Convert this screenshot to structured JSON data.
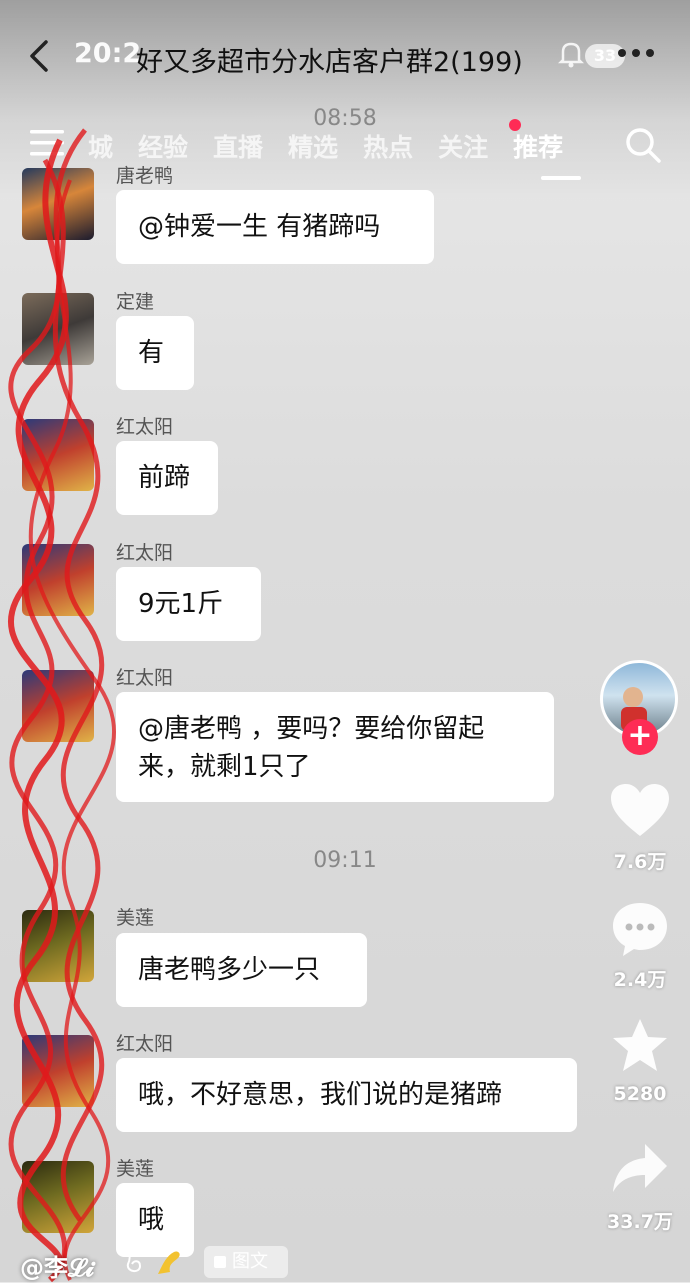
{
  "header": {
    "status_time": "20:2",
    "group_title": "好又多超市分水店客户群2(199)",
    "badge": "33"
  },
  "tabs": [
    {
      "label": "城"
    },
    {
      "label": "经验"
    },
    {
      "label": "直播"
    },
    {
      "label": "精选"
    },
    {
      "label": "热点"
    },
    {
      "label": "关注"
    },
    {
      "label": "推荐"
    }
  ],
  "active_tab": "推荐",
  "chat": {
    "time_1": "08:58",
    "time_2": "09:11",
    "messages": [
      {
        "sender": "唐老鸭",
        "text": "@钟爱一生 有猪蹄吗",
        "avatar": "city-night"
      },
      {
        "sender": "定建",
        "text": "有",
        "avatar": "street"
      },
      {
        "sender": "红太阳",
        "text": "前蹄",
        "avatar": "shop"
      },
      {
        "sender": "红太阳",
        "text": "9元1斤",
        "avatar": "shop"
      },
      {
        "sender": "红太阳",
        "text": "@唐老鸭 ，要吗？要给你留起来，就剩1只了",
        "avatar": "shop"
      },
      {
        "sender": "美莲",
        "text": "唐老鸭多少一只",
        "avatar": "flowers"
      },
      {
        "sender": "红太阳",
        "text": "哦，不好意思，我们说的是猪蹄",
        "avatar": "shop"
      },
      {
        "sender": "美莲",
        "text": "哦",
        "avatar": "flowers"
      }
    ]
  },
  "rail": {
    "likes": "7.6万",
    "comments": "2.4万",
    "favorites": "5280",
    "shares": "33.7万"
  },
  "footer": {
    "author": "@李𝓛𝓲",
    "image_tag": "图文"
  },
  "colors": {
    "accent": "#fe2c55",
    "bubble": "#ffffff",
    "scribble": "#e0191b"
  }
}
